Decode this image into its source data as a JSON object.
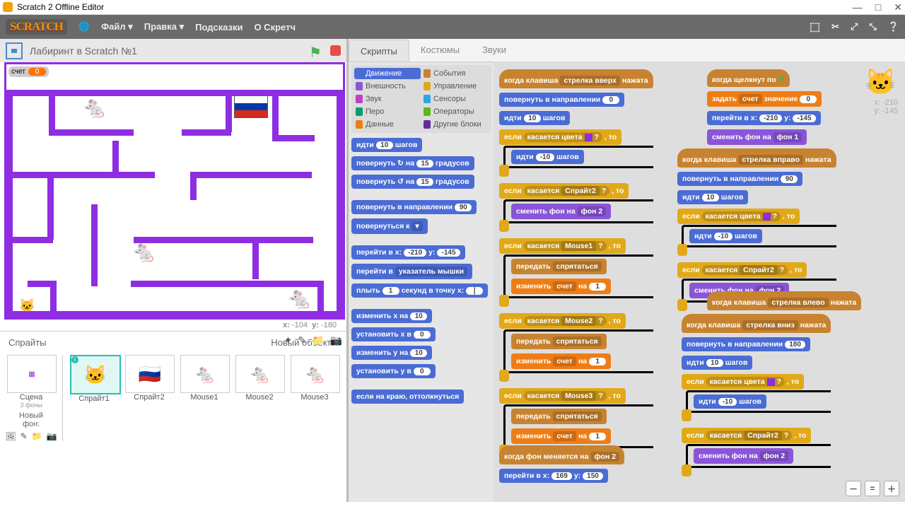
{
  "win": {
    "title": "Scratch 2 Offline Editor"
  },
  "menu": {
    "logo": "SCRATCH",
    "file": "Файл ▾",
    "edit": "Правка ▾",
    "tips": "Подсказки",
    "about": "О Скретч"
  },
  "stage": {
    "title": "Лабиринт в Scratch №1",
    "score_label": "счет",
    "score_val": "0",
    "x_lbl": "x:",
    "x": "-104",
    "y_lbl": "y:",
    "y": "-180"
  },
  "sprite_panel": {
    "header": "Спрайты",
    "newobj": "Новый объект:",
    "scene": "Сцена",
    "scene_sub": "3 фоны",
    "newbg": "Новый фон:",
    "sprites": [
      {
        "n": "Спрайт1",
        "e": "🐱"
      },
      {
        "n": "Спрайт2",
        "e": "🇷🇺"
      },
      {
        "n": "Mouse1",
        "e": "🐁"
      },
      {
        "n": "Mouse2",
        "e": "🐁"
      },
      {
        "n": "Mouse3",
        "e": "🐁"
      }
    ]
  },
  "tabs": {
    "scripts": "Скрипты",
    "costumes": "Костюмы",
    "sounds": "Звуки"
  },
  "cats": [
    {
      "n": "Движение",
      "c": "#4a6cd4",
      "sel": true
    },
    {
      "n": "События",
      "c": "#c88330"
    },
    {
      "n": "Внешность",
      "c": "#8a55d7"
    },
    {
      "n": "Управление",
      "c": "#e1a91a"
    },
    {
      "n": "Звук",
      "c": "#bb42c3"
    },
    {
      "n": "Сенсоры",
      "c": "#2ca5e2"
    },
    {
      "n": "Перо",
      "c": "#0e9a6c"
    },
    {
      "n": "Операторы",
      "c": "#5cb712"
    },
    {
      "n": "Данные",
      "c": "#ee7d16"
    },
    {
      "n": "Другие блоки",
      "c": "#632d99"
    }
  ],
  "palette": {
    "move": "идти",
    "steps": "шагов",
    "turn_cw": "повернуть ↻ на",
    "turn_ccw": "повернуть ↺ на",
    "deg": "градусов",
    "point_dir": "повернуть в направлении",
    "point_to": "повернуться к",
    "goto_xy": "перейти в x:",
    "y": "y:",
    "goto": "перейти в",
    "mouse_ptr": "указатель мышки",
    "glide": "плыть",
    "sec_to": "секунд в точку x:",
    "change_x": "изменить x на",
    "set_x": "установить х в",
    "change_y": "изменить y на",
    "set_y": "установить y в",
    "edge": "если на краю, оттолкнуться",
    "v_move": "10",
    "v_turn": "15",
    "v_dir": "90",
    "v_x": "-210",
    "v_y": "-145",
    "v_g": "1"
  },
  "xy": {
    "x": "x: -210",
    "y": "y: -145"
  },
  "s": {
    "when_key": "когда клавиша",
    "arrow_up": "стрелка вверх",
    "arrow_right": "стрелка вправо",
    "arrow_left": "стрелка влево",
    "arrow_down": "стрелка вниз",
    "pressed": "нажата",
    "when_flag": "когда щелкнут по",
    "set": "задать",
    "score": "счет",
    "value": "значение",
    "goto_x": "перейти в x:",
    "switch_bg": "сменить фон на",
    "bg1": "фон 1",
    "bg2": "фон 2",
    "point": "повернуть в направлении",
    "move": "идти",
    "steps": "шагов",
    "if": "если",
    "then": ", то",
    "touch_color": "касается цвета",
    "touch": "касается",
    "sprite2": "Спрайт2",
    "mouse1": "Mouse1",
    "mouse2": "Mouse2",
    "mouse3": "Mouse3",
    "broadcast": "передать",
    "hide": "спрятаться",
    "change": "изменить",
    "by": "на",
    "when_bg": "когда фон меняется на",
    "q": "?",
    "y": "y:",
    "v0": "0",
    "v10": "10",
    "vn10": "-10",
    "v90": "90",
    "v180": "180",
    "v1": "1",
    "vx": "-210",
    "vy": "-145",
    "gx": "169",
    "gy": "150"
  }
}
